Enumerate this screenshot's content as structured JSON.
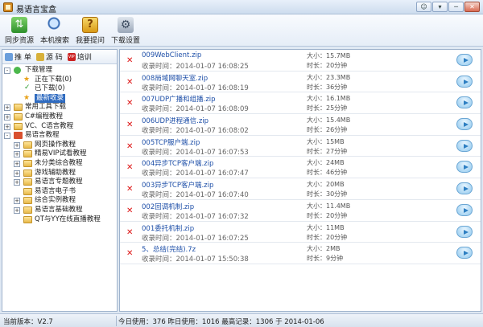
{
  "window": {
    "title": "易语言宝盒",
    "buttons": [
      "☺",
      "▾",
      "─",
      "✕"
    ]
  },
  "toolbar": [
    {
      "label": "同步资源",
      "icon": "sync-icon"
    },
    {
      "label": "本机搜索",
      "icon": "search-icon"
    },
    {
      "label": "我要提问",
      "icon": "question-icon"
    },
    {
      "label": "下载设置",
      "icon": "settings-icon"
    }
  ],
  "sidebar": {
    "tabs": [
      "推 单",
      "源 码",
      "培训"
    ],
    "tree": [
      {
        "label": "下载管理",
        "level": 0,
        "exp": "-",
        "icon": "green"
      },
      {
        "label": "正在下载(0)",
        "level": 1,
        "exp": "",
        "icon": "star"
      },
      {
        "label": "已下载(0)",
        "level": 1,
        "exp": "",
        "icon": "check"
      },
      {
        "label": "最新收录",
        "level": 1,
        "exp": "",
        "icon": "star",
        "selected": true
      },
      {
        "label": "常用工具下载",
        "level": 0,
        "exp": "+",
        "icon": "yellow"
      },
      {
        "label": "C#编程教程",
        "level": 0,
        "exp": "+",
        "icon": "yellow"
      },
      {
        "label": "VC、C语言教程",
        "level": 0,
        "exp": "+",
        "icon": "yellow"
      },
      {
        "label": "易语言教程",
        "level": 0,
        "exp": "-",
        "icon": "red"
      },
      {
        "label": "网页操作教程",
        "level": 1,
        "exp": "+",
        "icon": "yellow"
      },
      {
        "label": "精易VIP试看教程",
        "level": 1,
        "exp": "+",
        "icon": "yellow"
      },
      {
        "label": "未分类综合教程",
        "level": 1,
        "exp": "+",
        "icon": "yellow"
      },
      {
        "label": "游戏辅助教程",
        "level": 1,
        "exp": "+",
        "icon": "yellow"
      },
      {
        "label": "易语言专题教程",
        "level": 1,
        "exp": "+",
        "icon": "yellow"
      },
      {
        "label": "易语言电子书",
        "level": 1,
        "exp": "",
        "icon": "yellow"
      },
      {
        "label": "综合实例教程",
        "level": 1,
        "exp": "+",
        "icon": "yellow"
      },
      {
        "label": "易语言基础教程",
        "level": 1,
        "exp": "+",
        "icon": "yellow"
      },
      {
        "label": "QT与YY在线直播教程",
        "level": 1,
        "exp": "",
        "icon": "yellow"
      }
    ]
  },
  "list": {
    "rows": [
      {
        "name": "009WebClient.zip",
        "time": "收录时间：2014-01-07 16:08:25",
        "size": "大小：15.7MB",
        "dur": "时长：20分钟"
      },
      {
        "name": "008局域网聊天室.zip",
        "time": "收录时间：2014-01-07 16:08:19",
        "size": "大小：23.3MB",
        "dur": "时长：36分钟"
      },
      {
        "name": "007UDP广播和组播.zip",
        "time": "收录时间：2014-01-07 16:08:09",
        "size": "大小：16.1MB",
        "dur": "时长：25分钟"
      },
      {
        "name": "006UDP进程通信.zip",
        "time": "收录时间：2014-01-07 16:08:02",
        "size": "大小：15.4MB",
        "dur": "时长：26分钟"
      },
      {
        "name": "005TCP服户端.zip",
        "time": "收录时间：2014-01-07 16:07:53",
        "size": "大小：15MB",
        "dur": "时长：27分钟"
      },
      {
        "name": "004异步TCP客户端.zip",
        "time": "收录时间：2014-01-07 16:07:47",
        "size": "大小：24MB",
        "dur": "时长：46分钟"
      },
      {
        "name": "003异步TCP客户端.zip",
        "time": "收录时间：2014-01-07 16:07:40",
        "size": "大小：20MB",
        "dur": "时长：30分钟"
      },
      {
        "name": "002回调机制.zip",
        "time": "收录时间：2014-01-07 16:07:32",
        "size": "大小：11.4MB",
        "dur": "时长：20分钟"
      },
      {
        "name": "001委托机制.zip",
        "time": "收录时间：2014-01-07 16:07:25",
        "size": "大小：11MB",
        "dur": "时长：20分钟"
      },
      {
        "name": "5、总结(完结).7z",
        "time": "收录时间：2014-01-07 15:50:38",
        "size": "大小：2MB",
        "dur": "时长：9分钟"
      }
    ]
  },
  "status": {
    "version": "当前版本：V2.7",
    "stats": "今日使用：376   昨日使用：1016   最高记录：1306 于 2014-01-06"
  }
}
